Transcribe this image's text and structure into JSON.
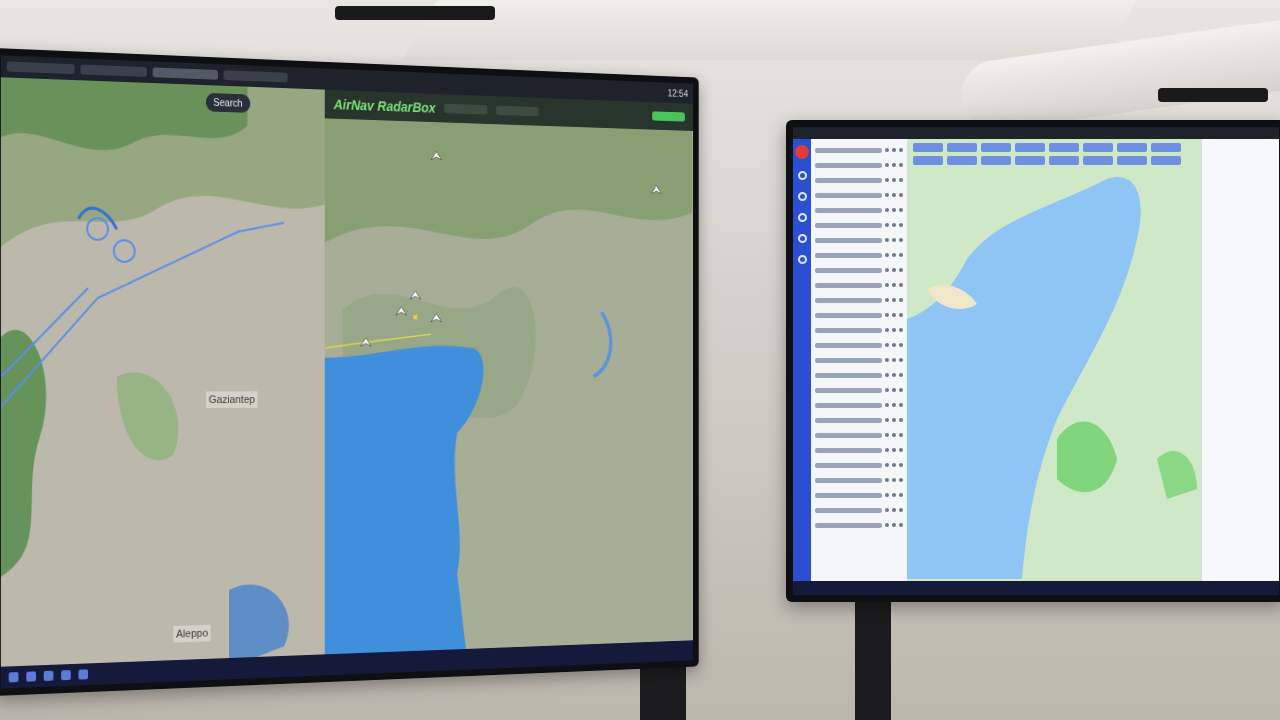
{
  "left_monitor": {
    "terrain_map": {
      "search": "Search",
      "labels": [
        "Gaziantep",
        "Aleppo"
      ]
    },
    "radar": {
      "logo": "AirNav RadarBox"
    },
    "clock": "12:54"
  }
}
